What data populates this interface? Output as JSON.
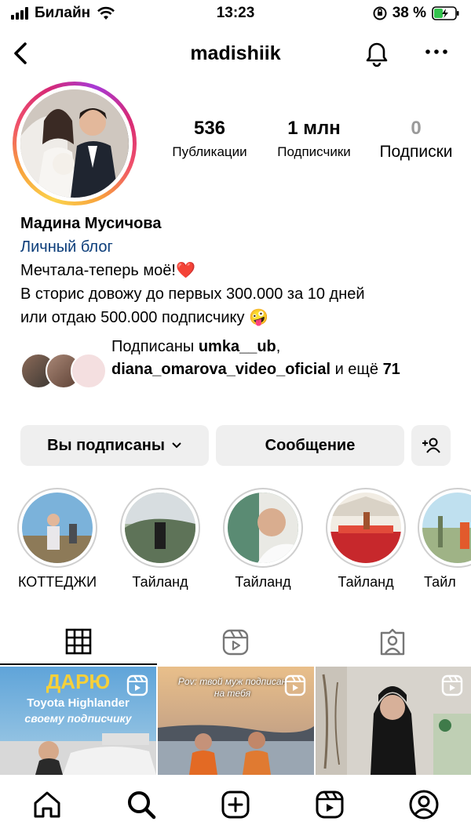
{
  "status": {
    "carrier": "Билайн",
    "time": "13:23",
    "battery": "38 %"
  },
  "header": {
    "username": "madishiik"
  },
  "stats": [
    {
      "num": "536",
      "label": "Публикации"
    },
    {
      "num": "1 млн",
      "label": "Подписчики"
    },
    {
      "num": "0",
      "label": "Подписки"
    }
  ],
  "bio": {
    "name": "Мадина Мусичова",
    "category": "Личный блог",
    "line1": "Мечтала-теперь моё!❤️",
    "line2": "В сторис довожу до первых 300.000 за 10 дней",
    "line3": "или отдаю 500.000 подписчику 🤪"
  },
  "followed_by": {
    "prefix": "Подписаны ",
    "user1": "umka__ub",
    "sep": ",",
    "user2": "diana_omarova_video_oficial",
    "and": " и ещё ",
    "count": "71"
  },
  "buttons": {
    "following": "Вы подписаны",
    "message": "Сообщение"
  },
  "highlights": [
    "КОТТЕДЖИ",
    "Тайланд",
    "Тайланд",
    "Тайланд",
    "Тайл"
  ],
  "posts": [
    {
      "title": "ДАРЮ",
      "line1": "Toyota Highlander",
      "line2": "своему подписчику"
    },
    {
      "caption": "Pov: твой муж подписан на тебя"
    },
    {
      "caption": ""
    }
  ],
  "colors": {
    "category_blue": "#0b3d7a",
    "button_bg": "#efefef",
    "heart": "#e0245e"
  }
}
